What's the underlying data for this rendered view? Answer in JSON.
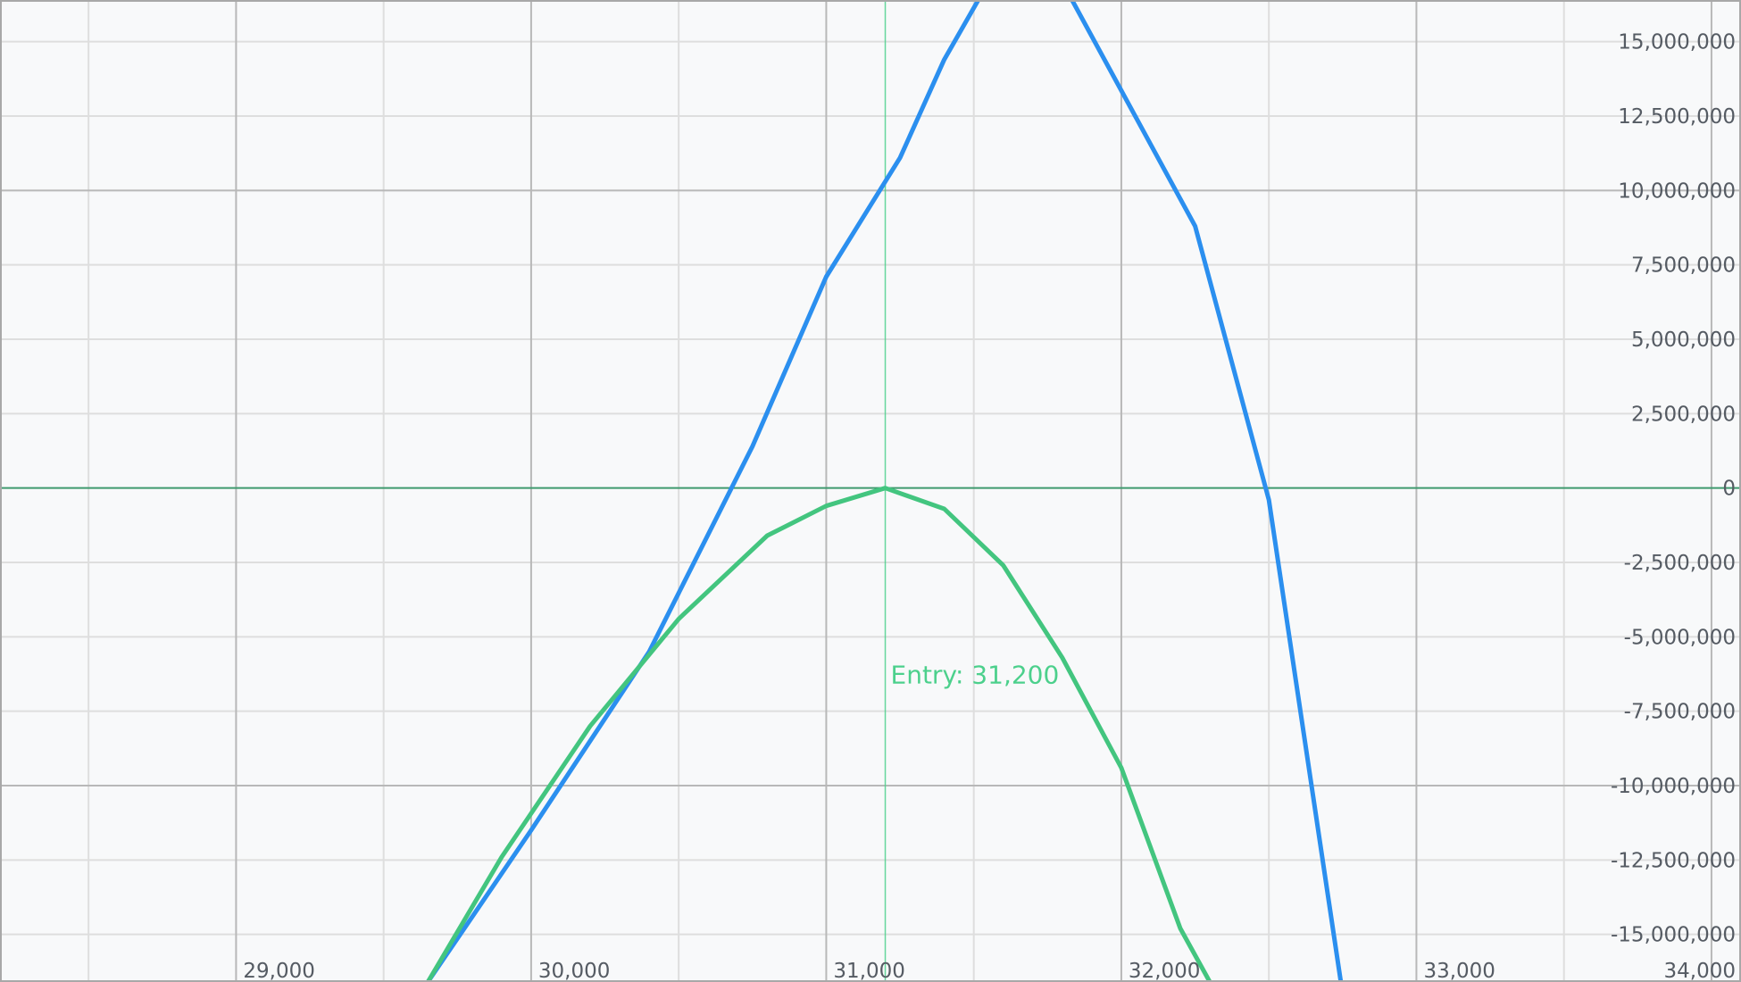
{
  "chart_data": {
    "type": "line",
    "title": "",
    "xlabel": "",
    "ylabel": "",
    "xlim": [
      28200,
      34100
    ],
    "ylim": [
      -16600000,
      16400000
    ],
    "x_ticks": [
      {
        "value": 29000,
        "label": "29,000"
      },
      {
        "value": 30000,
        "label": "30,000"
      },
      {
        "value": 31000,
        "label": "31,000"
      },
      {
        "value": 32000,
        "label": "32,000"
      },
      {
        "value": 33000,
        "label": "33,000"
      },
      {
        "value": 34000,
        "label": "34,000"
      }
    ],
    "y_ticks": [
      {
        "value": 15000000,
        "label": "15,000,000"
      },
      {
        "value": 12500000,
        "label": "12,500,000"
      },
      {
        "value": 10000000,
        "label": "10,000,000"
      },
      {
        "value": 7500000,
        "label": "7,500,000"
      },
      {
        "value": 5000000,
        "label": "5,000,000"
      },
      {
        "value": 2500000,
        "label": "2,500,000"
      },
      {
        "value": 0,
        "label": "0"
      },
      {
        "value": -2500000,
        "label": "-2,500,000"
      },
      {
        "value": -5000000,
        "label": "-5,000,000"
      },
      {
        "value": -7500000,
        "label": "-7,500,000"
      },
      {
        "value": -10000000,
        "label": "-10,000,000"
      },
      {
        "value": -12500000,
        "label": "-12,500,000"
      },
      {
        "value": -15000000,
        "label": "-15,000,000"
      }
    ],
    "grid": true,
    "entry": {
      "value": 31200,
      "label": "Entry: 31,200",
      "color": "#4cd08c"
    },
    "colors": {
      "background": "#f8f9fa",
      "grid_major": "#b8b8b8",
      "grid_minor": "#dedede",
      "zero_line": "#3f9a6e",
      "tick_text": "#555b63"
    },
    "series": [
      {
        "color": "#2b8fef",
        "x": [
          29650,
          30000,
          30400,
          30750,
          31000,
          31250,
          31400,
          31550,
          31800,
          32250,
          32500,
          32750
        ],
        "y": [
          -16600000,
          -11500000,
          -5500000,
          1400000,
          7100000,
          11100000,
          14400000,
          17000000,
          17000000,
          8800000,
          -400000,
          -17000000
        ]
      },
      {
        "color": "#43c57f",
        "x": [
          29650,
          29900,
          30200,
          30500,
          30800,
          31000,
          31200,
          31400,
          31600,
          31800,
          32000,
          32200,
          32300
        ],
        "y": [
          -16600000,
          -12400000,
          -8000000,
          -4400000,
          -1600000,
          -600000,
          0,
          -700000,
          -2600000,
          -5700000,
          -9400000,
          -14800000,
          -16600000
        ]
      }
    ]
  }
}
